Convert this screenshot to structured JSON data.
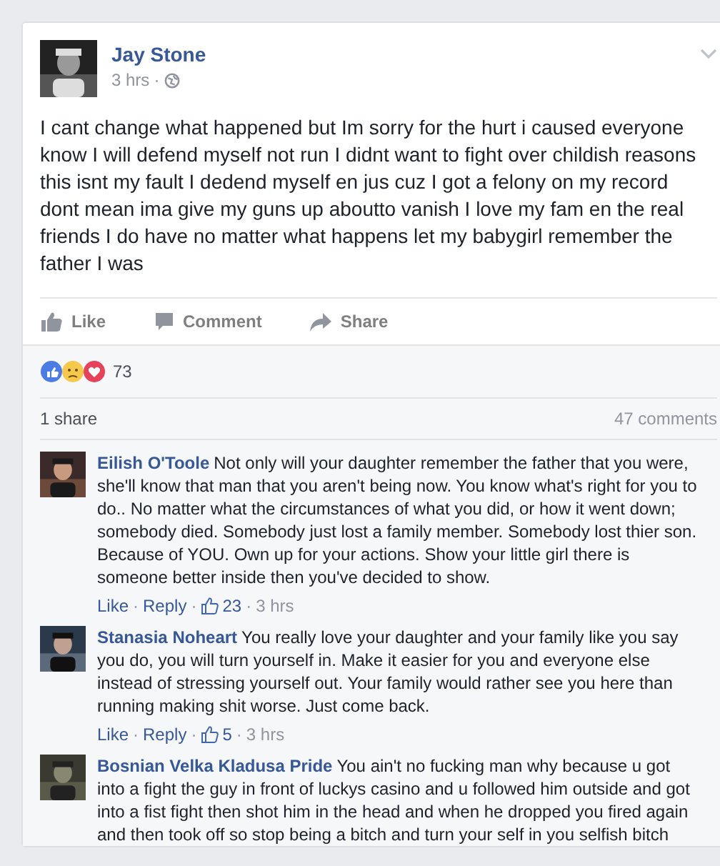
{
  "separator": "·",
  "post": {
    "author": "Jay Stone",
    "time": "3 hrs",
    "text": "I cant change what happened but Im sorry for the hurt i caused everyone know I will defend myself not run I didnt want to fight over childish reasons this isnt my fault I dedend myself en jus cuz I got a felony on my record dont mean ima give my guns up aboutto vanish I love my fam en the real friends I do have no matter what happens let my babygirl remember the father I was",
    "actions": [
      {
        "kind": "like",
        "label": "Like"
      },
      {
        "kind": "comment",
        "label": "Comment"
      },
      {
        "kind": "share",
        "label": "Share"
      }
    ],
    "reactions": {
      "count": "73"
    },
    "shares": "1 share",
    "comments_count": "47 comments"
  },
  "comments": [
    {
      "author": "Eilish O'Toole",
      "text": "Not only will your daughter remember the father that you were, she'll know that man that you aren't being now. You know what's right for you to do.. No matter what the circumstances of what you did, or how it went down; somebody died. Somebody just lost a family member. Somebody lost thier son. Because of YOU. Own up for your actions. Show your little girl there is someone better inside then you've decided to show.",
      "like": "Like",
      "reply": "Reply",
      "likes": "23",
      "time": "3 hrs"
    },
    {
      "author": "Stanasia Noheart",
      "text": "You really love your daughter and your family like you say you do, you will turn yourself in. Make it easier for you and everyone else instead of stressing yourself out. Your family would rather see you here than running making shit worse. Just come back.",
      "like": "Like",
      "reply": "Reply",
      "likes": "5",
      "time": "3 hrs"
    },
    {
      "author": "Bosnian Velka Kladusa Pride",
      "text": "You ain't no fucking man why because u got into a fight the guy in front of luckys casino and u followed him outside and got into a fist fight then shot him in the head and when he dropped you fired again and then took off so stop being a bitch and turn your self in you selfish bitch"
    }
  ]
}
